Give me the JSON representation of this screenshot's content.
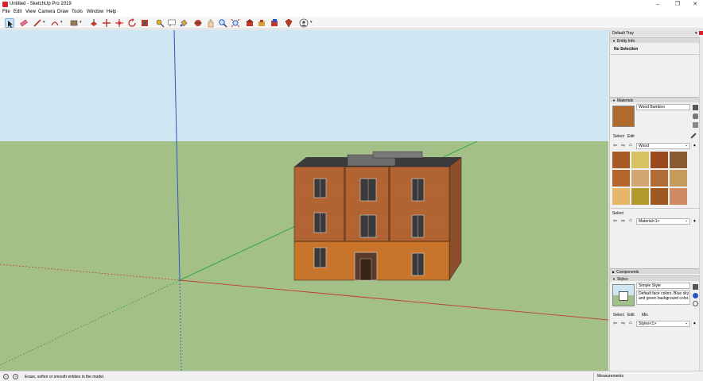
{
  "window": {
    "title": "Untitled - SketchUp Pro 2019",
    "minimize_glyph": "–",
    "restore_glyph": "❐",
    "close_glyph": "✕"
  },
  "menu": [
    "File",
    "Edit",
    "View",
    "Camera",
    "Draw",
    "Tools",
    "Window",
    "Help"
  ],
  "toolbar": {
    "tools": [
      "select-icon",
      "eraser-icon",
      "line-icon",
      "arc-icon",
      "rectangle-icon",
      "push-pull-icon",
      "move-icon",
      "rotate-icon",
      "scale-icon",
      "offset-icon",
      "tape-measure-icon",
      "text-icon",
      "paint-bucket-icon",
      "orbit-icon",
      "pan-icon",
      "zoom-icon",
      "zoom-extents-icon",
      "warehouse-icon",
      "extension-warehouse-icon",
      "layout-icon",
      "ruby-icon",
      "account-icon"
    ]
  },
  "tray": {
    "title": "Default Tray",
    "entity_info": {
      "header": "Entity Info",
      "value": "No Selection"
    },
    "materials": {
      "header": "Materials",
      "name": "Wood Bamboo",
      "tab_select": "Select",
      "tab_edit": "Edit",
      "library": "Wood",
      "swatch_colors": [
        "#a85a24",
        "#d7c361",
        "#9b4a1f",
        "#8a5a33",
        "#b5652c",
        "#d2a774",
        "#b06d38",
        "#c79b5c",
        "#e6b66a",
        "#b49a2e",
        "#9e5823",
        "#cf8c64"
      ],
      "select_label": "Select",
      "model_dropdown": "Material<1>",
      "accent_color": "#b06a2c"
    },
    "components": {
      "header": "Components"
    },
    "styles": {
      "header": "Styles",
      "name": "Simple Style",
      "description": "Default face colors. Blue sky and green background color.",
      "tab_select": "Select",
      "tab_edit": "Edit",
      "tab_mix": "Mix",
      "dropdown": "Styles<1>"
    }
  },
  "scene": {
    "sky_color": "#cfe6f4",
    "ground_color": "#a4c089",
    "axis_red": "#c0392b",
    "axis_green": "#2e9e3a",
    "axis_blue": "#2a55c7",
    "brick_color": "#b26533",
    "base_color": "#c9742b",
    "roof_color": "#3b3b3b"
  },
  "status": {
    "hint": "Erase, soften or smooth entities in the model.",
    "measurements_label": "Measurements"
  }
}
